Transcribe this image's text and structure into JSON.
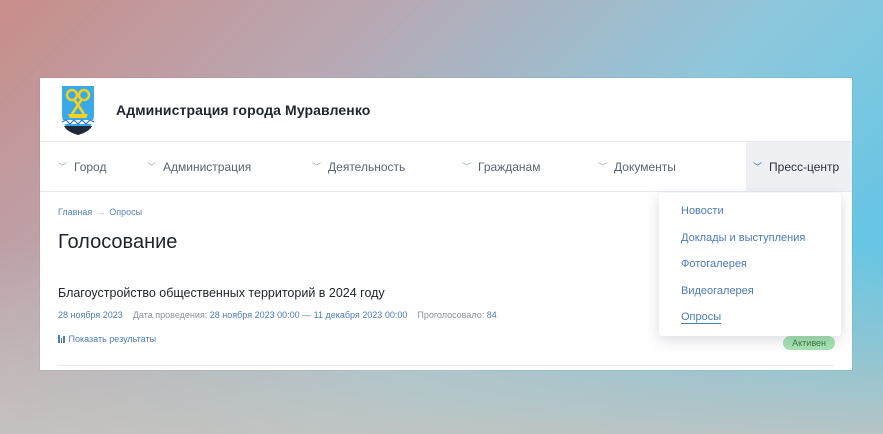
{
  "header": {
    "site_title": "Администрация города Муравленко"
  },
  "nav": {
    "items": [
      {
        "label": "Город"
      },
      {
        "label": "Администрация"
      },
      {
        "label": "Деятельность"
      },
      {
        "label": "Гражданам"
      },
      {
        "label": "Документы"
      },
      {
        "label": "Пресс-центр",
        "active": true
      }
    ]
  },
  "breadcrumb": {
    "home": "Главная",
    "separator": "→",
    "current": "Опросы"
  },
  "page": {
    "title": "Голосование"
  },
  "poll": {
    "title": "Благоустройство общественных территорий в 2024 году",
    "date": "28 ноября 2023",
    "period_label": "Дата проведения:",
    "period_value": "28 ноября 2023 00:00 — 11 декабря 2023 00:00",
    "votes_label": "Проголосовало:",
    "votes_value": "84",
    "results_link": "Показать результаты",
    "status": "Активен"
  },
  "dropdown": {
    "items": [
      {
        "label": "Новости"
      },
      {
        "label": "Доклады и выступления"
      },
      {
        "label": "Фотогалерея"
      },
      {
        "label": "Видеогалерея"
      },
      {
        "label": "Опросы",
        "selected": true
      }
    ]
  },
  "colors": {
    "accent": "#4b7cb3",
    "status_bg": "#a6e3b2",
    "status_text": "#3f7d4b",
    "logo_blue": "#3aa9e8",
    "logo_yellow": "#f4d21f"
  },
  "icons": {
    "nav_chevron": "chevron-down-icon",
    "results": "bar-chart-icon",
    "logo": "coat-of-arms-icon"
  }
}
